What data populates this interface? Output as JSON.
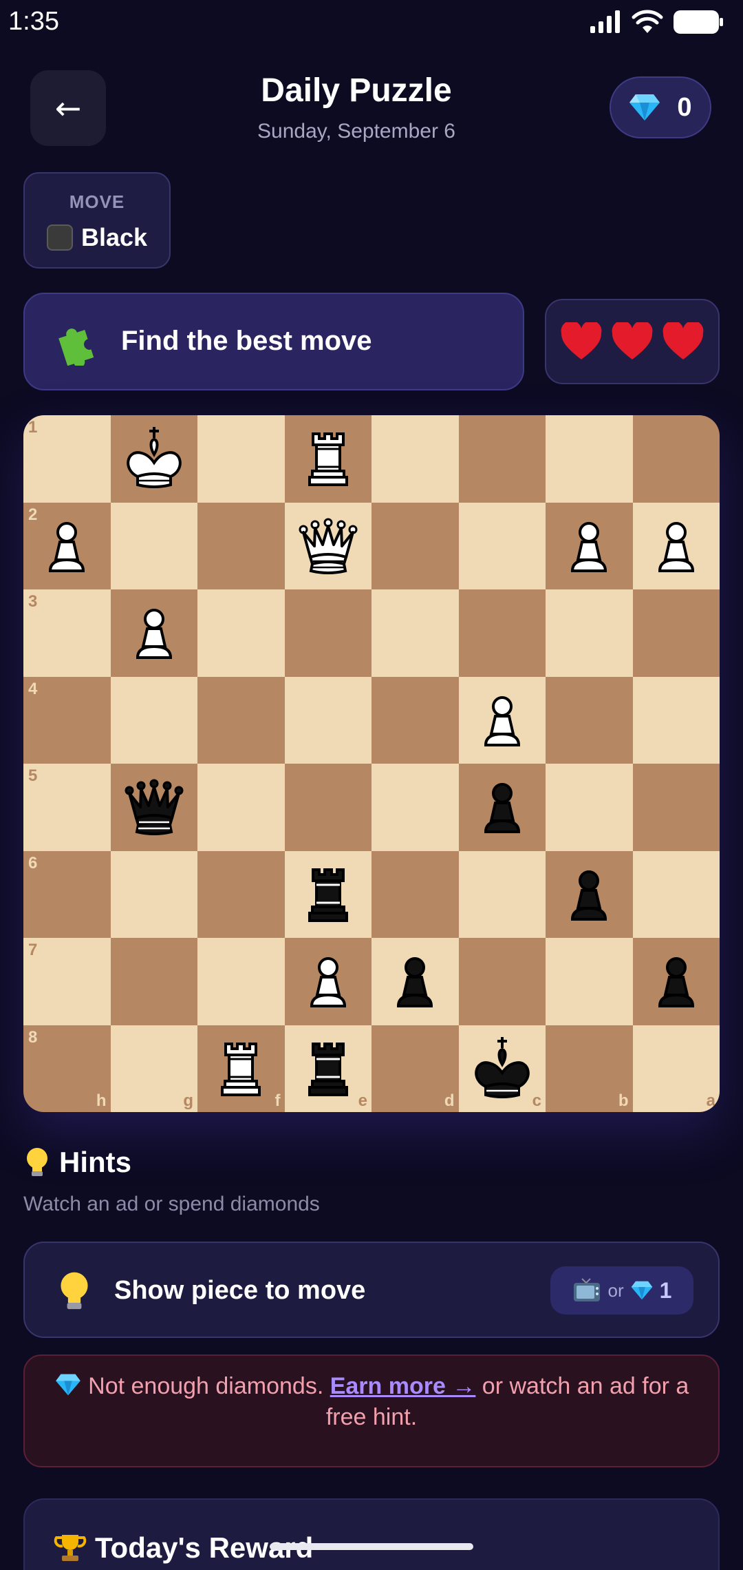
{
  "status_bar": {
    "time": "1:35"
  },
  "header": {
    "back_icon": "arrow-left-icon",
    "back_glyph": "←",
    "title": "Daily Puzzle",
    "date": "Sunday, September 6",
    "diamond_count": "0"
  },
  "move": {
    "label": "MOVE",
    "side": "Black"
  },
  "task": {
    "icon": "puzzle-piece-icon",
    "text": "Find the best move"
  },
  "lives": {
    "count": 3,
    "icon": "heart-icon"
  },
  "board": {
    "light_color": "#f0d9b5",
    "dark_color": "#b58863",
    "rank_labels": [
      "1",
      "2",
      "3",
      "4",
      "5",
      "6",
      "7",
      "8"
    ],
    "file_labels": [
      "h",
      "g",
      "f",
      "e",
      "d",
      "c",
      "b",
      "a"
    ],
    "pieces": [
      {
        "square": "g1",
        "piece": "K",
        "color": "white"
      },
      {
        "square": "e1",
        "piece": "R",
        "color": "white"
      },
      {
        "square": "h2",
        "piece": "P",
        "color": "white"
      },
      {
        "square": "e2",
        "piece": "Q",
        "color": "white"
      },
      {
        "square": "b2",
        "piece": "P",
        "color": "white"
      },
      {
        "square": "a2",
        "piece": "P",
        "color": "white"
      },
      {
        "square": "g3",
        "piece": "P",
        "color": "white"
      },
      {
        "square": "c4",
        "piece": "P",
        "color": "white"
      },
      {
        "square": "g5",
        "piece": "Q",
        "color": "black"
      },
      {
        "square": "c5",
        "piece": "P",
        "color": "black"
      },
      {
        "square": "e6",
        "piece": "R",
        "color": "black"
      },
      {
        "square": "b6",
        "piece": "P",
        "color": "black"
      },
      {
        "square": "e7",
        "piece": "P",
        "color": "white"
      },
      {
        "square": "d7",
        "piece": "P",
        "color": "black"
      },
      {
        "square": "a7",
        "piece": "P",
        "color": "black"
      },
      {
        "square": "f8",
        "piece": "R",
        "color": "white"
      },
      {
        "square": "e8",
        "piece": "R",
        "color": "black"
      },
      {
        "square": "c8",
        "piece": "K",
        "color": "black"
      }
    ]
  },
  "hints": {
    "icon": "lightbulb-icon",
    "title": "Hints",
    "subtitle": "Watch an ad or spend diamonds",
    "option": {
      "label": "Show piece to move",
      "ad_icon": "tv-icon",
      "or_text": "or",
      "diamond_cost": "1"
    }
  },
  "warning": {
    "text_before": "Not enough diamonds.",
    "link": "Earn more →",
    "text_after": "or watch an ad for a free hint."
  },
  "reward": {
    "icon": "trophy-icon",
    "title": "Today's Reward"
  },
  "colors": {
    "background": "#0c0b22",
    "accent": "#a88cff",
    "warning_text": "#f3a0ae",
    "diamond": "#27b6f5",
    "heart": "#e31b2a"
  }
}
